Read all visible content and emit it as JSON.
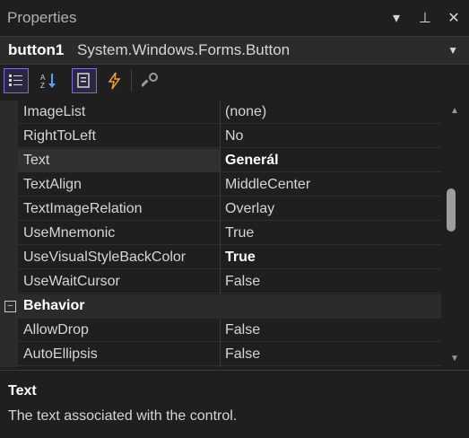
{
  "window": {
    "title": "Properties",
    "controls": [
      {
        "icon": "dropdown-icon",
        "glyph": "▾"
      },
      {
        "icon": "pin-icon",
        "glyph": "⊥"
      },
      {
        "icon": "close-icon",
        "glyph": "✕"
      }
    ]
  },
  "object_selector": {
    "name": "button1",
    "type": "System.Windows.Forms.Button"
  },
  "toolbar": {
    "buttons": [
      {
        "name": "categorized-icon",
        "active": true
      },
      {
        "name": "alphabetical-icon",
        "active": false
      },
      {
        "name": "properties-icon",
        "active": true
      },
      {
        "name": "events-icon",
        "active": false
      },
      {
        "name": "property-pages-icon",
        "active": false
      }
    ]
  },
  "properties": {
    "rows": [
      {
        "name": "ImageList",
        "value": "(none)",
        "bold": false
      },
      {
        "name": "RightToLeft",
        "value": "No",
        "bold": false
      },
      {
        "name": "Text",
        "value": "Generál",
        "bold": true
      },
      {
        "name": "TextAlign",
        "value": "MiddleCenter",
        "bold": false
      },
      {
        "name": "TextImageRelation",
        "value": "Overlay",
        "bold": false
      },
      {
        "name": "UseMnemonic",
        "value": "True",
        "bold": false
      },
      {
        "name": "UseVisualStyleBackColor",
        "value": "True",
        "bold": true
      },
      {
        "name": "UseWaitCursor",
        "value": "False",
        "bold": false
      }
    ],
    "category": {
      "label": "Behavior",
      "toggle": "−"
    },
    "rows2": [
      {
        "name": "AllowDrop",
        "value": "False",
        "bold": false
      },
      {
        "name": "AutoEllipsis",
        "value": "False",
        "bold": false
      }
    ]
  },
  "description": {
    "title": "Text",
    "text": "The text associated with the control."
  },
  "colors": {
    "accent": "#7a6fd6",
    "background": "#1f1f1f",
    "grid": "#2b2b2b"
  }
}
